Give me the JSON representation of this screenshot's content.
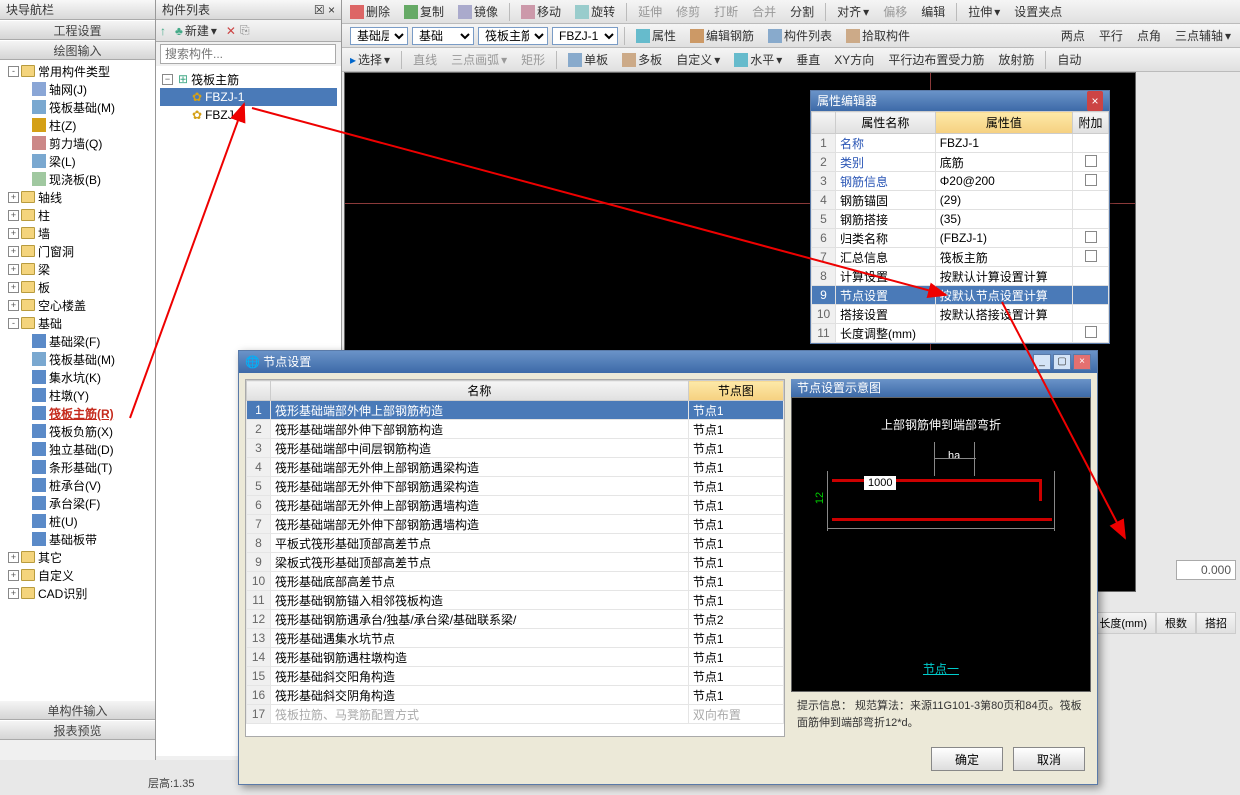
{
  "panels": {
    "nav_title": "块导航栏",
    "comp_list_title": "构件列表",
    "project_settings": "工程设置",
    "drawing_input": "绘图输入",
    "single_input": "单构件输入",
    "report_preview": "报表预览"
  },
  "toolbars": {
    "row1": [
      "删除",
      "复制",
      "镜像",
      "移动",
      "旋转",
      "延伸",
      "修剪",
      "打断",
      "合并",
      "分割",
      "对齐",
      "偏移",
      "编辑",
      "拉伸",
      "设置夹点"
    ],
    "row2_selects": {
      "floor": "基础层",
      "cat": "基础",
      "type": "筏板主筋",
      "inst": "FBZJ-1"
    },
    "row2_btns": [
      "属性",
      "编辑钢筋",
      "构件列表",
      "拾取构件",
      "两点",
      "平行",
      "点角",
      "三点辅轴"
    ],
    "row3": [
      "选择",
      "直线",
      "三点画弧",
      "矩形",
      "单板",
      "多板",
      "自定义",
      "水平",
      "垂直",
      "XY方向",
      "平行边布置受力筋",
      "放射筋",
      "自动"
    ]
  },
  "nav_tree": [
    {
      "label": "常用构件类型",
      "indent": 0,
      "toggle": "-",
      "folder": true
    },
    {
      "label": "轴网(J)",
      "indent": 2,
      "icon": "#8aa6d6"
    },
    {
      "label": "筏板基础(M)",
      "indent": 2,
      "icon": "#7aa8d0"
    },
    {
      "label": "柱(Z)",
      "indent": 2,
      "icon": "#d4a017"
    },
    {
      "label": "剪力墙(Q)",
      "indent": 2,
      "icon": "#c88"
    },
    {
      "label": "梁(L)",
      "indent": 2,
      "icon": "#7aa8d0"
    },
    {
      "label": "现浇板(B)",
      "indent": 2,
      "icon": "#a0c8a0"
    },
    {
      "label": "轴线",
      "indent": 0,
      "toggle": "+",
      "folder": true
    },
    {
      "label": "柱",
      "indent": 0,
      "toggle": "+",
      "folder": true
    },
    {
      "label": "墙",
      "indent": 0,
      "toggle": "+",
      "folder": true
    },
    {
      "label": "门窗洞",
      "indent": 0,
      "toggle": "+",
      "folder": true
    },
    {
      "label": "梁",
      "indent": 0,
      "toggle": "+",
      "folder": true
    },
    {
      "label": "板",
      "indent": 0,
      "toggle": "+",
      "folder": true
    },
    {
      "label": "空心楼盖",
      "indent": 0,
      "toggle": "+",
      "folder": true
    },
    {
      "label": "基础",
      "indent": 0,
      "toggle": "-",
      "folder": true
    },
    {
      "label": "基础梁(F)",
      "indent": 2,
      "icon": "#5a8ac8"
    },
    {
      "label": "筏板基础(M)",
      "indent": 2,
      "icon": "#7aa8d0"
    },
    {
      "label": "集水坑(K)",
      "indent": 2,
      "icon": "#5a8ac8"
    },
    {
      "label": "柱墩(Y)",
      "indent": 2,
      "icon": "#5a8ac8"
    },
    {
      "label": "筏板主筋(R)",
      "indent": 2,
      "icon": "#5a8ac8",
      "highlight": true
    },
    {
      "label": "筏板负筋(X)",
      "indent": 2,
      "icon": "#5a8ac8"
    },
    {
      "label": "独立基础(D)",
      "indent": 2,
      "icon": "#5a8ac8"
    },
    {
      "label": "条形基础(T)",
      "indent": 2,
      "icon": "#5a8ac8"
    },
    {
      "label": "桩承台(V)",
      "indent": 2,
      "icon": "#5a8ac8"
    },
    {
      "label": "承台梁(F)",
      "indent": 2,
      "icon": "#5a8ac8"
    },
    {
      "label": "桩(U)",
      "indent": 2,
      "icon": "#5a8ac8"
    },
    {
      "label": "基础板带",
      "indent": 2,
      "icon": "#5a8ac8"
    },
    {
      "label": "其它",
      "indent": 0,
      "toggle": "+",
      "folder": true
    },
    {
      "label": "自定义",
      "indent": 0,
      "toggle": "+",
      "folder": true
    },
    {
      "label": "CAD识别",
      "indent": 0,
      "toggle": "+",
      "folder": true
    }
  ],
  "comp_panel": {
    "new_btn": "新建",
    "search_placeholder": "搜索构件...",
    "root": "筏板主筋",
    "items": [
      {
        "label": "FBZJ-1",
        "selected": true
      },
      {
        "label": "FBZJ-2"
      }
    ]
  },
  "props": {
    "title": "属性编辑器",
    "cols": {
      "name": "属性名称",
      "value": "属性值",
      "extra": "附加"
    },
    "rows": [
      {
        "n": "1",
        "name": "名称",
        "val": "FBZJ-1",
        "link": true
      },
      {
        "n": "2",
        "name": "类别",
        "val": "底筋",
        "link": true,
        "chk": true
      },
      {
        "n": "3",
        "name": "钢筋信息",
        "val": "Φ20@200",
        "link": true,
        "chk": true
      },
      {
        "n": "4",
        "name": "钢筋锚固",
        "val": "(29)"
      },
      {
        "n": "5",
        "name": "钢筋搭接",
        "val": "(35)"
      },
      {
        "n": "6",
        "name": "归类名称",
        "val": "(FBZJ-1)",
        "chk": true
      },
      {
        "n": "7",
        "name": "汇总信息",
        "val": "筏板主筋",
        "chk": true
      },
      {
        "n": "8",
        "name": "计算设置",
        "val": "按默认计算设置计算"
      },
      {
        "n": "9",
        "name": "节点设置",
        "val": "按默认节点设置计算",
        "selected": true
      },
      {
        "n": "10",
        "name": "搭接设置",
        "val": "按默认搭接设置计算"
      },
      {
        "n": "11",
        "name": "长度调整(mm)",
        "val": "",
        "chk": true
      }
    ]
  },
  "dialog": {
    "title": "节点设置",
    "cols": {
      "name": "名称",
      "node": "节点图"
    },
    "rows": [
      {
        "n": "1",
        "name": "筏形基础端部外伸上部钢筋构造",
        "val": "节点1",
        "selected": true
      },
      {
        "n": "2",
        "name": "筏形基础端部外伸下部钢筋构造",
        "val": "节点1"
      },
      {
        "n": "3",
        "name": "筏形基础端部中间层钢筋构造",
        "val": "节点1"
      },
      {
        "n": "4",
        "name": "筏形基础端部无外伸上部钢筋遇梁构造",
        "val": "节点1"
      },
      {
        "n": "5",
        "name": "筏形基础端部无外伸下部钢筋遇梁构造",
        "val": "节点1"
      },
      {
        "n": "6",
        "name": "筏形基础端部无外伸上部钢筋遇墙构造",
        "val": "节点1"
      },
      {
        "n": "7",
        "name": "筏形基础端部无外伸下部钢筋遇墙构造",
        "val": "节点1"
      },
      {
        "n": "8",
        "name": "平板式筏形基础顶部高差节点",
        "val": "节点1"
      },
      {
        "n": "9",
        "name": "梁板式筏形基础顶部高差节点",
        "val": "节点1"
      },
      {
        "n": "10",
        "name": "筏形基础底部高差节点",
        "val": "节点1"
      },
      {
        "n": "11",
        "name": "筏形基础钢筋锚入相邻筏板构造",
        "val": "节点1"
      },
      {
        "n": "12",
        "name": "筏形基础钢筋遇承台/独基/承台梁/基础联系梁/",
        "val": "节点2"
      },
      {
        "n": "13",
        "name": "筏形基础遇集水坑节点",
        "val": "节点1"
      },
      {
        "n": "14",
        "name": "筏形基础钢筋遇柱墩构造",
        "val": "节点1"
      },
      {
        "n": "15",
        "name": "筏形基础斜交阳角构造",
        "val": "节点1"
      },
      {
        "n": "16",
        "name": "筏形基础斜交阴角构造",
        "val": "节点1"
      },
      {
        "n": "17",
        "name": "筏板拉筋、马凳筋配置方式",
        "val": "双向布置",
        "gray": true
      }
    ],
    "preview_title": "节点设置示意图",
    "preview_heading": "上部钢筋伸到端部弯折",
    "preview_ha": "ha",
    "preview_1000": "1000",
    "preview_12": "12",
    "preview_node": "节点一",
    "hint": "提示信息： 规范算法：来源11G101-3第80页和84页。筏板面筋伸到端部弯折12*d。",
    "ok": "确定",
    "cancel": "取消"
  },
  "right": {
    "value": "0.000",
    "headers": [
      "长度(mm)",
      "根数",
      "搭招"
    ]
  },
  "status": "层高:1.35"
}
